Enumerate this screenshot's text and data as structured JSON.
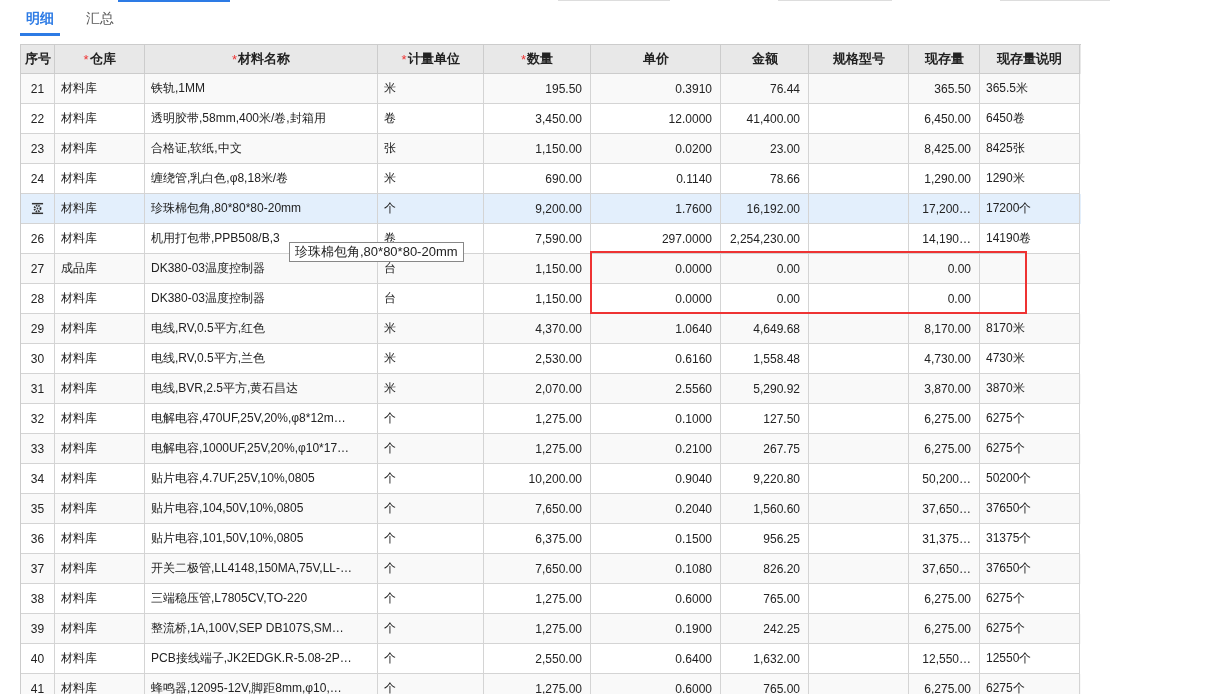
{
  "tabs": [
    {
      "label": "明细",
      "selected": true
    },
    {
      "label": "汇总",
      "selected": false
    }
  ],
  "table": {
    "columns": [
      {
        "label": "序号"
      },
      {
        "label": "仓库",
        "required_mark": "*"
      },
      {
        "label": "材料名称",
        "required_mark": "*"
      },
      {
        "label": "计量单位",
        "required_mark": "*"
      },
      {
        "label": "数量",
        "required_mark": "*"
      },
      {
        "label": "单价"
      },
      {
        "label": "金额"
      },
      {
        "label": "规格型号"
      },
      {
        "label": "现存量"
      },
      {
        "label": "现存量说明"
      }
    ],
    "rows": [
      {
        "no": "21",
        "warehouse": "材料库",
        "name": "铁轨,1MM",
        "unit": "米",
        "qty": "195.50",
        "price": "0.3910",
        "amount": "76.44",
        "stock": "365.50",
        "stock_note": "365.5米",
        "selected": false,
        "highlighted": false
      },
      {
        "no": "22",
        "warehouse": "材料库",
        "name": "透明胶带,58mm,400米/卷,封箱用",
        "unit": "卷",
        "qty": "3,450.00",
        "price": "12.0000",
        "amount": "41,400.00",
        "stock": "6,450.00",
        "stock_note": "6450卷",
        "selected": false,
        "highlighted": false
      },
      {
        "no": "23",
        "warehouse": "材料库",
        "name": "合格证,软纸,中文",
        "unit": "张",
        "qty": "1,150.00",
        "price": "0.0200",
        "amount": "23.00",
        "stock": "8,425.00",
        "stock_note": "8425张",
        "selected": false,
        "highlighted": false
      },
      {
        "no": "24",
        "warehouse": "材料库",
        "name": "缠绕管,乳白色,φ8,18米/卷",
        "unit": "米",
        "qty": "690.00",
        "price": "0.1140",
        "amount": "78.66",
        "stock": "1,290.00",
        "stock_note": "1290米",
        "selected": false,
        "highlighted": false
      },
      {
        "warehouse": "材料库",
        "name": "珍珠棉包角,80*80*80-20mm",
        "unit": "个",
        "qty": "9,200.00",
        "price": "1.7600",
        "amount": "16,192.00",
        "stock": "17,200…",
        "stock_note": "17200个",
        "selected": true,
        "highlighted": false
      },
      {
        "no": "26",
        "warehouse": "材料库",
        "name": "机用打包带,PPB508/B,3",
        "unit": "卷",
        "qty": "7,590.00",
        "price": "297.0000",
        "amount": "2,254,230.00",
        "stock": "14,190…",
        "stock_note": "14190卷",
        "selected": false,
        "highlighted": false
      },
      {
        "no": "27",
        "warehouse": "成品库",
        "name": "DK380-03温度控制器",
        "unit": "台",
        "qty": "1,150.00",
        "price": "0.0000",
        "amount": "0.00",
        "stock": "0.00",
        "selected": false,
        "highlighted": true
      },
      {
        "no": "28",
        "warehouse": "材料库",
        "name": "DK380-03温度控制器",
        "unit": "台",
        "qty": "1,150.00",
        "price": "0.0000",
        "amount": "0.00",
        "stock": "0.00",
        "selected": false,
        "highlighted": true
      },
      {
        "no": "29",
        "warehouse": "材料库",
        "name": "电线,RV,0.5平方,红色",
        "unit": "米",
        "qty": "4,370.00",
        "price": "1.0640",
        "amount": "4,649.68",
        "stock": "8,170.00",
        "stock_note": "8170米",
        "selected": false,
        "highlighted": false
      },
      {
        "no": "30",
        "warehouse": "材料库",
        "name": "电线,RV,0.5平方,兰色",
        "unit": "米",
        "qty": "2,530.00",
        "price": "0.6160",
        "amount": "1,558.48",
        "stock": "4,730.00",
        "stock_note": "4730米",
        "selected": false,
        "highlighted": false
      },
      {
        "no": "31",
        "warehouse": "材料库",
        "name": "电线,BVR,2.5平方,黄石昌达",
        "unit": "米",
        "qty": "2,070.00",
        "price": "2.5560",
        "amount": "5,290.92",
        "stock": "3,870.00",
        "stock_note": "3870米",
        "selected": false,
        "highlighted": false
      },
      {
        "no": "32",
        "warehouse": "材料库",
        "name": "电解电容,470UF,25V,20%,φ8*12m…",
        "unit": "个",
        "qty": "1,275.00",
        "price": "0.1000",
        "amount": "127.50",
        "stock": "6,275.00",
        "stock_note": "6275个",
        "selected": false,
        "highlighted": false
      },
      {
        "no": "33",
        "warehouse": "材料库",
        "name": "电解电容,1000UF,25V,20%,φ10*17…",
        "unit": "个",
        "qty": "1,275.00",
        "price": "0.2100",
        "amount": "267.75",
        "stock": "6,275.00",
        "stock_note": "6275个",
        "selected": false,
        "highlighted": false
      },
      {
        "no": "34",
        "warehouse": "材料库",
        "name": "贴片电容,4.7UF,25V,10%,0805",
        "unit": "个",
        "qty": "10,200.00",
        "price": "0.9040",
        "amount": "9,220.80",
        "stock": "50,200…",
        "stock_note": "50200个",
        "selected": false,
        "highlighted": false
      },
      {
        "no": "35",
        "warehouse": "材料库",
        "name": "贴片电容,104,50V,10%,0805",
        "unit": "个",
        "qty": "7,650.00",
        "price": "0.2040",
        "amount": "1,560.60",
        "stock": "37,650…",
        "stock_note": "37650个",
        "selected": false,
        "highlighted": false
      },
      {
        "no": "36",
        "warehouse": "材料库",
        "name": "贴片电容,101,50V,10%,0805",
        "unit": "个",
        "qty": "6,375.00",
        "price": "0.1500",
        "amount": "956.25",
        "stock": "31,375…",
        "stock_note": "31375个",
        "selected": false,
        "highlighted": false
      },
      {
        "no": "37",
        "warehouse": "材料库",
        "name": "开关二极管,LL4148,150MA,75V,LL-…",
        "unit": "个",
        "qty": "7,650.00",
        "price": "0.1080",
        "amount": "826.20",
        "stock": "37,650…",
        "stock_note": "37650个",
        "selected": false,
        "highlighted": false
      },
      {
        "no": "38",
        "warehouse": "材料库",
        "name": "三端稳压管,L7805CV,TO-220",
        "unit": "个",
        "qty": "1,275.00",
        "price": "0.6000",
        "amount": "765.00",
        "stock": "6,275.00",
        "stock_note": "6275个",
        "selected": false,
        "highlighted": false
      },
      {
        "no": "39",
        "warehouse": "材料库",
        "name": "整流桥,1A,100V,SEP DB107S,SM…",
        "unit": "个",
        "qty": "1,275.00",
        "price": "0.1900",
        "amount": "242.25",
        "stock": "6,275.00",
        "stock_note": "6275个",
        "selected": false,
        "highlighted": false
      },
      {
        "no": "40",
        "warehouse": "材料库",
        "name": "PCB接线端子,JK2EDGK.R-5.08-2P…",
        "unit": "个",
        "qty": "2,550.00",
        "price": "0.6400",
        "amount": "1,632.00",
        "stock": "12,550…",
        "stock_note": "12550个",
        "selected": false,
        "highlighted": false
      },
      {
        "no": "41",
        "warehouse": "材料库",
        "name": "蜂鸣器,12095-12V,脚距8mm,φ10,…",
        "unit": "个",
        "qty": "1,275.00",
        "price": "0.6000",
        "amount": "765.00",
        "stock": "6,275.00",
        "stock_note": "6275个",
        "selected": false,
        "highlighted": false
      }
    ]
  },
  "tooltip": {
    "text": "珍珠棉包角,80*80*80-20mm"
  }
}
